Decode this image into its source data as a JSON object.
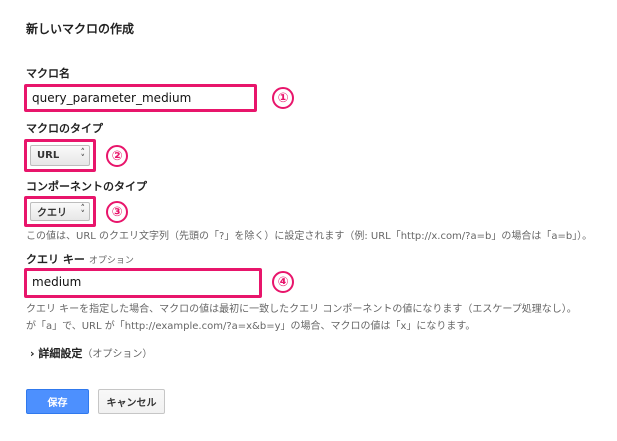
{
  "page": {
    "title": "新しいマクロの作成"
  },
  "macro_name": {
    "label": "マクロ名",
    "value": "query_parameter_medium",
    "marker": "①"
  },
  "macro_type": {
    "label": "マクロのタイプ",
    "selected": "URL",
    "marker": "②"
  },
  "component_type": {
    "label": "コンポーネントのタイプ",
    "selected": "クエリ",
    "marker": "③",
    "help": "この値は、URL のクエリ文字列（先頭の「?」を除く）に設定されます（例: URL「http://x.com/?a=b」の場合は「a=b」）。"
  },
  "query_key": {
    "label": "クエリ キー",
    "optional": "オプション",
    "value": "medium",
    "marker": "④",
    "help_line1": "クエリ キーを指定した場合、マクロの値は最初に一致したクエリ コンポーネントの値になります（エスケープ処理なし）。",
    "help_line2": "が「a」で、URL が「http://example.com/?a=x&b=y」の場合、マクロの値は「x」になります。"
  },
  "advanced": {
    "arrow": "›",
    "label": "詳細設定",
    "optional": "（オプション）"
  },
  "buttons": {
    "save": "保存",
    "cancel": "キャンセル"
  },
  "colors": {
    "highlight": "#e8156b",
    "primary_button": "#4d90fe"
  },
  "icons": {
    "select_arrows": "up-down-chevron-icon"
  }
}
